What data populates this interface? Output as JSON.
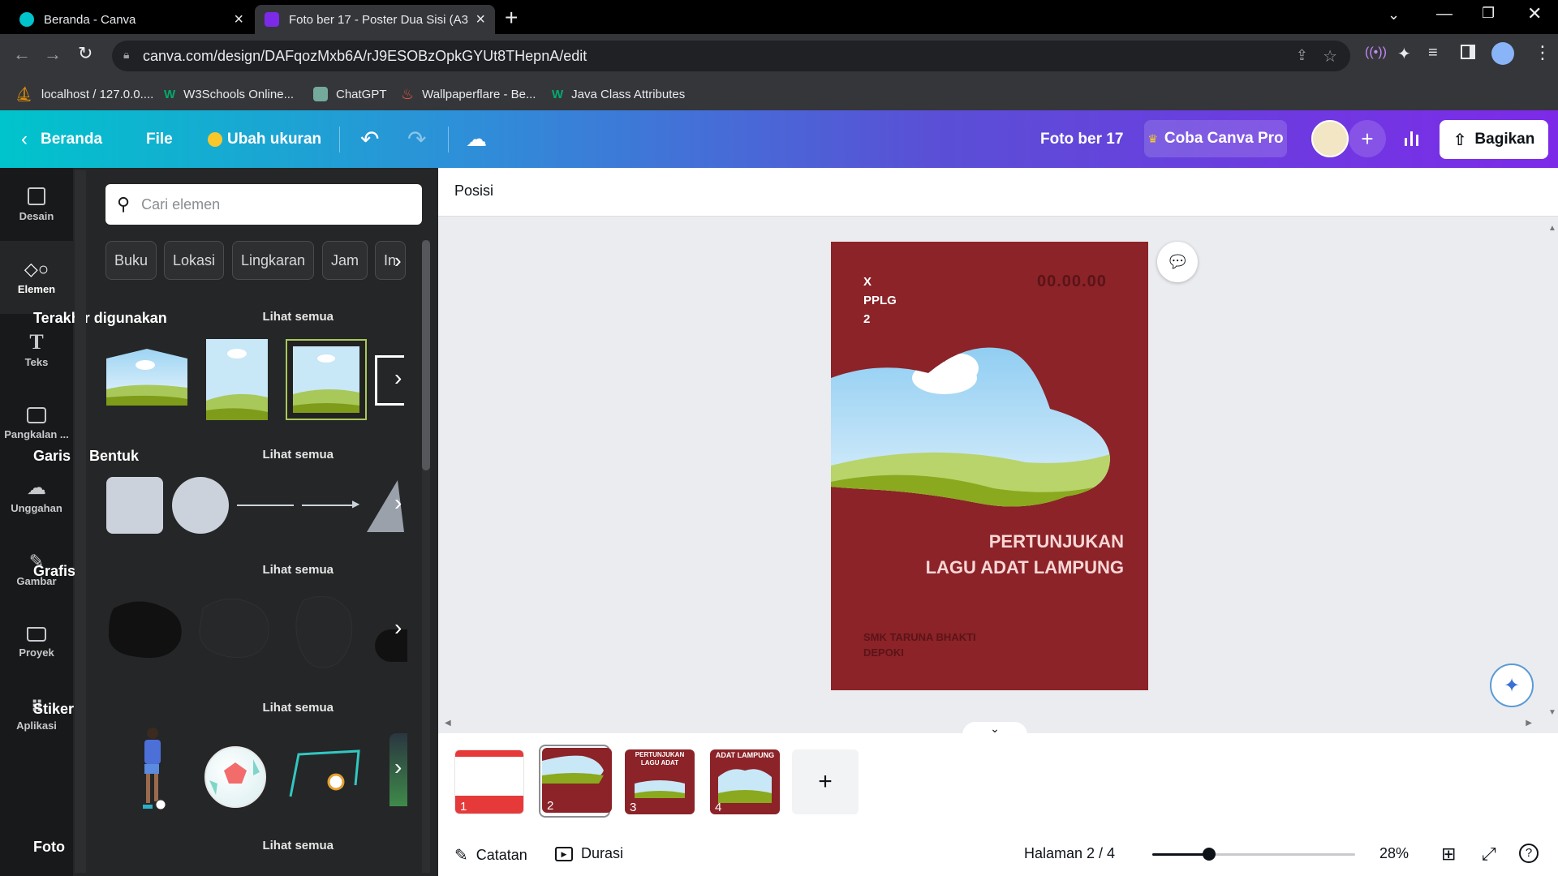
{
  "browser": {
    "tabs": [
      {
        "title": "Beranda - Canva",
        "active": false
      },
      {
        "title": "Foto ber 17 - Poster Dua Sisi (A3",
        "active": true
      }
    ],
    "url": "canva.com/design/DAFqozMxb6A/rJ9ESOBzOpkGYUt8THepnA/edit",
    "bookmarks": [
      "localhost / 127.0.0....",
      "W3Schools Online...",
      "ChatGPT",
      "Wallpaperflare - Be...",
      "Java Class Attributes"
    ]
  },
  "header": {
    "home_label": "Beranda",
    "file_label": "File",
    "resize_label": "Ubah ukuran",
    "design_title": "Foto ber 17",
    "pro_label": "Coba Canva Pro",
    "share_label": "Bagikan"
  },
  "rail": [
    {
      "label": "Desain",
      "icon": "layout-icon"
    },
    {
      "label": "Elemen",
      "icon": "shapes-icon"
    },
    {
      "label": "Teks",
      "icon": "text-icon"
    },
    {
      "label": "Pangkalan ...",
      "icon": "brand-kit-icon"
    },
    {
      "label": "Unggahan",
      "icon": "upload-cloud-icon"
    },
    {
      "label": "Gambar",
      "icon": "draw-icon"
    },
    {
      "label": "Proyek",
      "icon": "folder-icon"
    },
    {
      "label": "Aplikasi",
      "icon": "apps-grid-icon"
    }
  ],
  "panel": {
    "search_placeholder": "Cari elemen",
    "chips": [
      "Buku",
      "Lokasi",
      "Lingkaran",
      "Jam",
      "In"
    ],
    "see_all": "Lihat semua",
    "sections": {
      "recent": "Terakhir digunakan",
      "lines": "Garis & Bentuk",
      "graphics": "Grafis",
      "stickers": "Stiker",
      "photos": "Foto"
    }
  },
  "context_bar": {
    "position_label": "Posisi"
  },
  "poster": {
    "class_lines": [
      "X",
      "PPLG",
      "2"
    ],
    "time": "00.00.00",
    "title_lines": [
      "PERTUNJUKAN",
      "LAGU ADAT LAMPUNG"
    ],
    "school_lines": [
      "SMK TARUNA BHAKTI",
      "DEPOKI"
    ]
  },
  "thumbnails": [
    {
      "num": "1"
    },
    {
      "num": "2",
      "selected": true
    },
    {
      "num": "3",
      "caption": "PERTUNJUKAN LAGU ADAT"
    },
    {
      "num": "4",
      "caption": "ADAT LAMPUNG"
    }
  ],
  "footer": {
    "notes_label": "Catatan",
    "duration_label": "Durasi",
    "page_indicator": "Halaman 2 / 4",
    "zoom": "28%",
    "zoom_fraction": 0.28
  },
  "colors": {
    "poster_bg": "#8b2328",
    "accent": "#7d2ae8",
    "teal": "#00c4cc"
  }
}
